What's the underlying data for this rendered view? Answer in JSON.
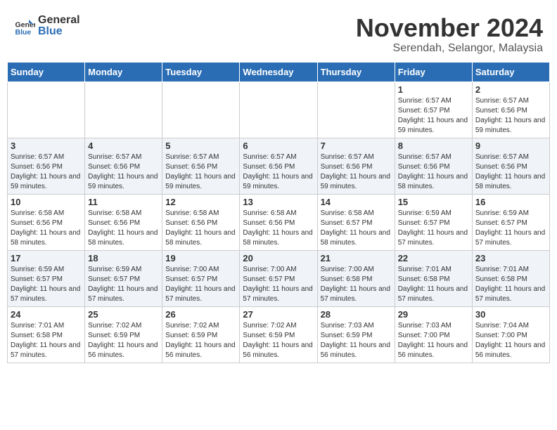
{
  "header": {
    "logo_general": "General",
    "logo_blue": "Blue",
    "month": "November 2024",
    "location": "Serendah, Selangor, Malaysia"
  },
  "weekdays": [
    "Sunday",
    "Monday",
    "Tuesday",
    "Wednesday",
    "Thursday",
    "Friday",
    "Saturday"
  ],
  "weeks": [
    [
      {
        "day": "",
        "sunrise": "",
        "sunset": "",
        "daylight": ""
      },
      {
        "day": "",
        "sunrise": "",
        "sunset": "",
        "daylight": ""
      },
      {
        "day": "",
        "sunrise": "",
        "sunset": "",
        "daylight": ""
      },
      {
        "day": "",
        "sunrise": "",
        "sunset": "",
        "daylight": ""
      },
      {
        "day": "",
        "sunrise": "",
        "sunset": "",
        "daylight": ""
      },
      {
        "day": "1",
        "sunrise": "Sunrise: 6:57 AM",
        "sunset": "Sunset: 6:57 PM",
        "daylight": "Daylight: 11 hours and 59 minutes."
      },
      {
        "day": "2",
        "sunrise": "Sunrise: 6:57 AM",
        "sunset": "Sunset: 6:56 PM",
        "daylight": "Daylight: 11 hours and 59 minutes."
      }
    ],
    [
      {
        "day": "3",
        "sunrise": "Sunrise: 6:57 AM",
        "sunset": "Sunset: 6:56 PM",
        "daylight": "Daylight: 11 hours and 59 minutes."
      },
      {
        "day": "4",
        "sunrise": "Sunrise: 6:57 AM",
        "sunset": "Sunset: 6:56 PM",
        "daylight": "Daylight: 11 hours and 59 minutes."
      },
      {
        "day": "5",
        "sunrise": "Sunrise: 6:57 AM",
        "sunset": "Sunset: 6:56 PM",
        "daylight": "Daylight: 11 hours and 59 minutes."
      },
      {
        "day": "6",
        "sunrise": "Sunrise: 6:57 AM",
        "sunset": "Sunset: 6:56 PM",
        "daylight": "Daylight: 11 hours and 59 minutes."
      },
      {
        "day": "7",
        "sunrise": "Sunrise: 6:57 AM",
        "sunset": "Sunset: 6:56 PM",
        "daylight": "Daylight: 11 hours and 59 minutes."
      },
      {
        "day": "8",
        "sunrise": "Sunrise: 6:57 AM",
        "sunset": "Sunset: 6:56 PM",
        "daylight": "Daylight: 11 hours and 58 minutes."
      },
      {
        "day": "9",
        "sunrise": "Sunrise: 6:57 AM",
        "sunset": "Sunset: 6:56 PM",
        "daylight": "Daylight: 11 hours and 58 minutes."
      }
    ],
    [
      {
        "day": "10",
        "sunrise": "Sunrise: 6:58 AM",
        "sunset": "Sunset: 6:56 PM",
        "daylight": "Daylight: 11 hours and 58 minutes."
      },
      {
        "day": "11",
        "sunrise": "Sunrise: 6:58 AM",
        "sunset": "Sunset: 6:56 PM",
        "daylight": "Daylight: 11 hours and 58 minutes."
      },
      {
        "day": "12",
        "sunrise": "Sunrise: 6:58 AM",
        "sunset": "Sunset: 6:56 PM",
        "daylight": "Daylight: 11 hours and 58 minutes."
      },
      {
        "day": "13",
        "sunrise": "Sunrise: 6:58 AM",
        "sunset": "Sunset: 6:56 PM",
        "daylight": "Daylight: 11 hours and 58 minutes."
      },
      {
        "day": "14",
        "sunrise": "Sunrise: 6:58 AM",
        "sunset": "Sunset: 6:57 PM",
        "daylight": "Daylight: 11 hours and 58 minutes."
      },
      {
        "day": "15",
        "sunrise": "Sunrise: 6:59 AM",
        "sunset": "Sunset: 6:57 PM",
        "daylight": "Daylight: 11 hours and 57 minutes."
      },
      {
        "day": "16",
        "sunrise": "Sunrise: 6:59 AM",
        "sunset": "Sunset: 6:57 PM",
        "daylight": "Daylight: 11 hours and 57 minutes."
      }
    ],
    [
      {
        "day": "17",
        "sunrise": "Sunrise: 6:59 AM",
        "sunset": "Sunset: 6:57 PM",
        "daylight": "Daylight: 11 hours and 57 minutes."
      },
      {
        "day": "18",
        "sunrise": "Sunrise: 6:59 AM",
        "sunset": "Sunset: 6:57 PM",
        "daylight": "Daylight: 11 hours and 57 minutes."
      },
      {
        "day": "19",
        "sunrise": "Sunrise: 7:00 AM",
        "sunset": "Sunset: 6:57 PM",
        "daylight": "Daylight: 11 hours and 57 minutes."
      },
      {
        "day": "20",
        "sunrise": "Sunrise: 7:00 AM",
        "sunset": "Sunset: 6:57 PM",
        "daylight": "Daylight: 11 hours and 57 minutes."
      },
      {
        "day": "21",
        "sunrise": "Sunrise: 7:00 AM",
        "sunset": "Sunset: 6:58 PM",
        "daylight": "Daylight: 11 hours and 57 minutes."
      },
      {
        "day": "22",
        "sunrise": "Sunrise: 7:01 AM",
        "sunset": "Sunset: 6:58 PM",
        "daylight": "Daylight: 11 hours and 57 minutes."
      },
      {
        "day": "23",
        "sunrise": "Sunrise: 7:01 AM",
        "sunset": "Sunset: 6:58 PM",
        "daylight": "Daylight: 11 hours and 57 minutes."
      }
    ],
    [
      {
        "day": "24",
        "sunrise": "Sunrise: 7:01 AM",
        "sunset": "Sunset: 6:58 PM",
        "daylight": "Daylight: 11 hours and 57 minutes."
      },
      {
        "day": "25",
        "sunrise": "Sunrise: 7:02 AM",
        "sunset": "Sunset: 6:59 PM",
        "daylight": "Daylight: 11 hours and 56 minutes."
      },
      {
        "day": "26",
        "sunrise": "Sunrise: 7:02 AM",
        "sunset": "Sunset: 6:59 PM",
        "daylight": "Daylight: 11 hours and 56 minutes."
      },
      {
        "day": "27",
        "sunrise": "Sunrise: 7:02 AM",
        "sunset": "Sunset: 6:59 PM",
        "daylight": "Daylight: 11 hours and 56 minutes."
      },
      {
        "day": "28",
        "sunrise": "Sunrise: 7:03 AM",
        "sunset": "Sunset: 6:59 PM",
        "daylight": "Daylight: 11 hours and 56 minutes."
      },
      {
        "day": "29",
        "sunrise": "Sunrise: 7:03 AM",
        "sunset": "Sunset: 7:00 PM",
        "daylight": "Daylight: 11 hours and 56 minutes."
      },
      {
        "day": "30",
        "sunrise": "Sunrise: 7:04 AM",
        "sunset": "Sunset: 7:00 PM",
        "daylight": "Daylight: 11 hours and 56 minutes."
      }
    ]
  ]
}
